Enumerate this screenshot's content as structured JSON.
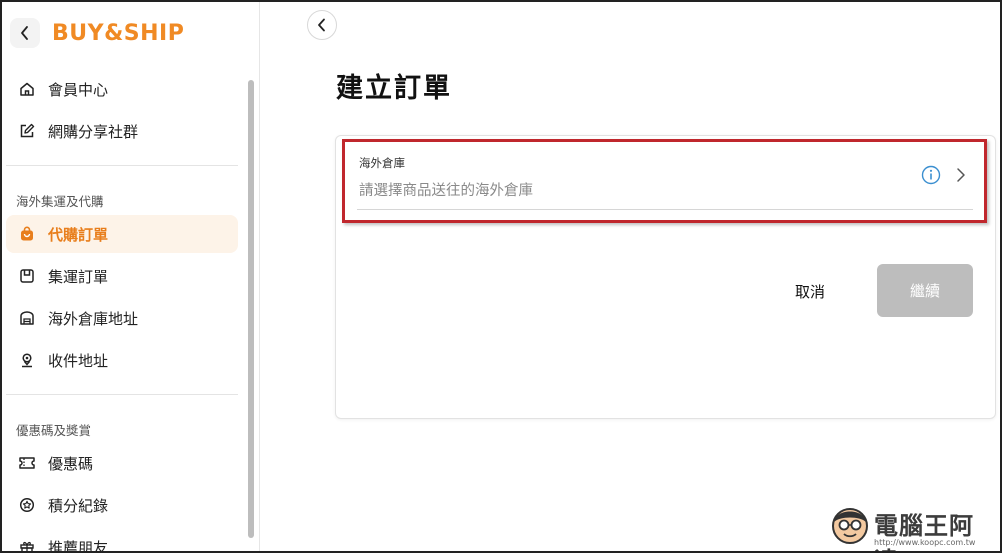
{
  "sidebar": {
    "brand": "BUY&SHIP",
    "items_top": [
      {
        "label": "會員中心",
        "icon": "home-icon"
      },
      {
        "label": "網購分享社群",
        "icon": "edit-icon"
      }
    ],
    "section1_label": "海外集運及代購",
    "items_section1": [
      {
        "label": "代購訂單",
        "icon": "shopping-bag-icon",
        "active": true
      },
      {
        "label": "集運訂單",
        "icon": "box-icon"
      },
      {
        "label": "海外倉庫地址",
        "icon": "warehouse-icon"
      },
      {
        "label": "收件地址",
        "icon": "location-pin-icon"
      }
    ],
    "section2_label": "優惠碼及獎賞",
    "items_section2": [
      {
        "label": "優惠碼",
        "icon": "coupon-icon"
      },
      {
        "label": "積分紀錄",
        "icon": "points-badge-icon"
      },
      {
        "label": "推薦朋友",
        "icon": "gift-icon"
      }
    ]
  },
  "main": {
    "title": "建立訂單",
    "warehouse_field": {
      "label": "海外倉庫",
      "placeholder": "請選擇商品送往的海外倉庫"
    },
    "cancel_label": "取消",
    "continue_label": "繼續"
  },
  "watermark": {
    "text": "電腦王阿達",
    "url": "http://www.koopc.com.tw"
  },
  "colors": {
    "brand": "#f08a24",
    "active_bg": "#fdf3e8",
    "highlight_border": "#c0272d",
    "disabled_button": "#bdbdbd",
    "info": "#3b8fd0"
  }
}
